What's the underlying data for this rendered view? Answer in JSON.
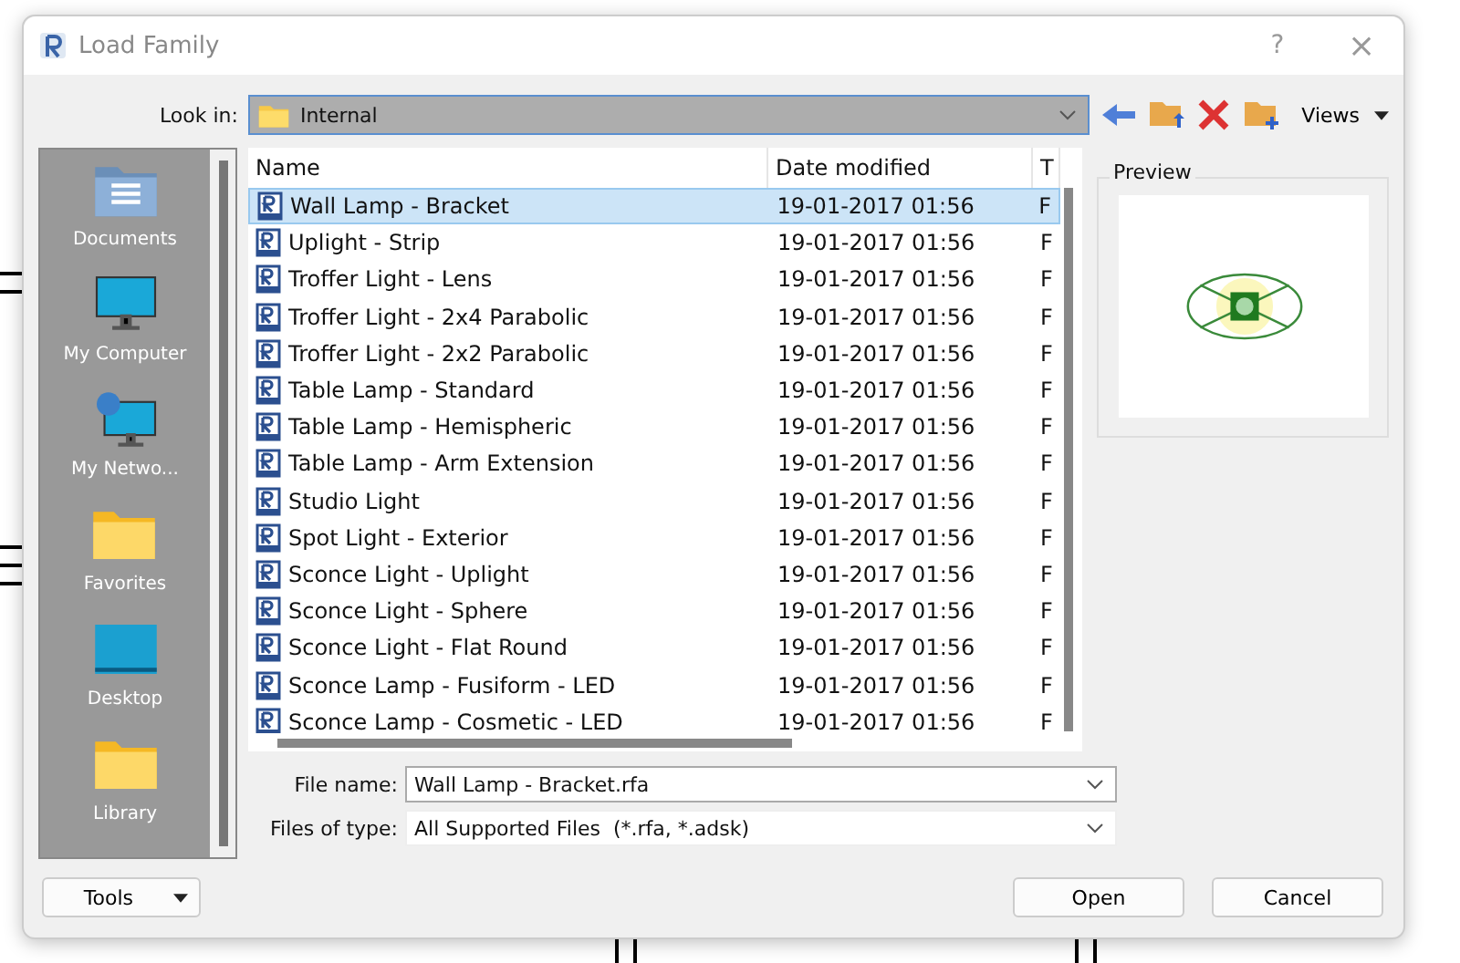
{
  "window": {
    "title": "Load Family",
    "help": "?",
    "close": "×"
  },
  "look_in": {
    "label": "Look in:",
    "value": "Internal"
  },
  "toolbar": {
    "views": "Views"
  },
  "places": [
    {
      "label": "Documents",
      "kind": "documents"
    },
    {
      "label": "My Computer",
      "kind": "computer"
    },
    {
      "label": "My Netwo...",
      "kind": "network"
    },
    {
      "label": "Favorites",
      "kind": "folder"
    },
    {
      "label": "Desktop",
      "kind": "desktop"
    },
    {
      "label": "Library",
      "kind": "folder"
    }
  ],
  "table": {
    "columns": [
      "Name",
      "Date modified",
      "T"
    ],
    "rows": [
      {
        "name": "Wall Lamp - Bracket",
        "date": "19-01-2017 01:56",
        "column_3": "F",
        "selected": true
      },
      {
        "name": "Uplight - Strip",
        "date": "19-01-2017 01:56",
        "column_3": "F",
        "selected": false
      },
      {
        "name": "Troffer Light - Lens",
        "date": "19-01-2017 01:56",
        "column_3": "F",
        "selected": false
      },
      {
        "name": "Troffer Light - 2x4 Parabolic",
        "date": "19-01-2017 01:56",
        "column_3": "F",
        "selected": false
      },
      {
        "name": "Troffer Light - 2x2 Parabolic",
        "date": "19-01-2017 01:56",
        "column_3": "F",
        "selected": false
      },
      {
        "name": "Table Lamp - Standard",
        "date": "19-01-2017 01:56",
        "column_3": "F",
        "selected": false
      },
      {
        "name": "Table Lamp - Hemispheric",
        "date": "19-01-2017 01:56",
        "column_3": "F",
        "selected": false
      },
      {
        "name": "Table Lamp - Arm Extension",
        "date": "19-01-2017 01:56",
        "column_3": "F",
        "selected": false
      },
      {
        "name": "Studio Light",
        "date": "19-01-2017 01:56",
        "column_3": "F",
        "selected": false
      },
      {
        "name": "Spot Light - Exterior",
        "date": "19-01-2017 01:56",
        "column_3": "F",
        "selected": false
      },
      {
        "name": "Sconce Light - Uplight",
        "date": "19-01-2017 01:56",
        "column_3": "F",
        "selected": false
      },
      {
        "name": "Sconce Light - Sphere",
        "date": "19-01-2017 01:56",
        "column_3": "F",
        "selected": false
      },
      {
        "name": "Sconce Light - Flat Round",
        "date": "19-01-2017 01:56",
        "column_3": "F",
        "selected": false
      },
      {
        "name": "Sconce Lamp - Fusiform - LED",
        "date": "19-01-2017 01:56",
        "column_3": "F",
        "selected": false
      },
      {
        "name": "Sconce Lamp - Cosmetic - LED",
        "date": "19-01-2017 01:56",
        "column_3": "F",
        "selected": false
      }
    ]
  },
  "preview": {
    "label": "Preview"
  },
  "file_name": {
    "label": "File name:",
    "value": "Wall Lamp - Bracket.rfa"
  },
  "file_type": {
    "label": "Files of type:",
    "value": "All Supported Files  (*.rfa, *.adsk)"
  },
  "buttons": {
    "tools": "Tools",
    "open": "Open",
    "cancel": "Cancel"
  }
}
